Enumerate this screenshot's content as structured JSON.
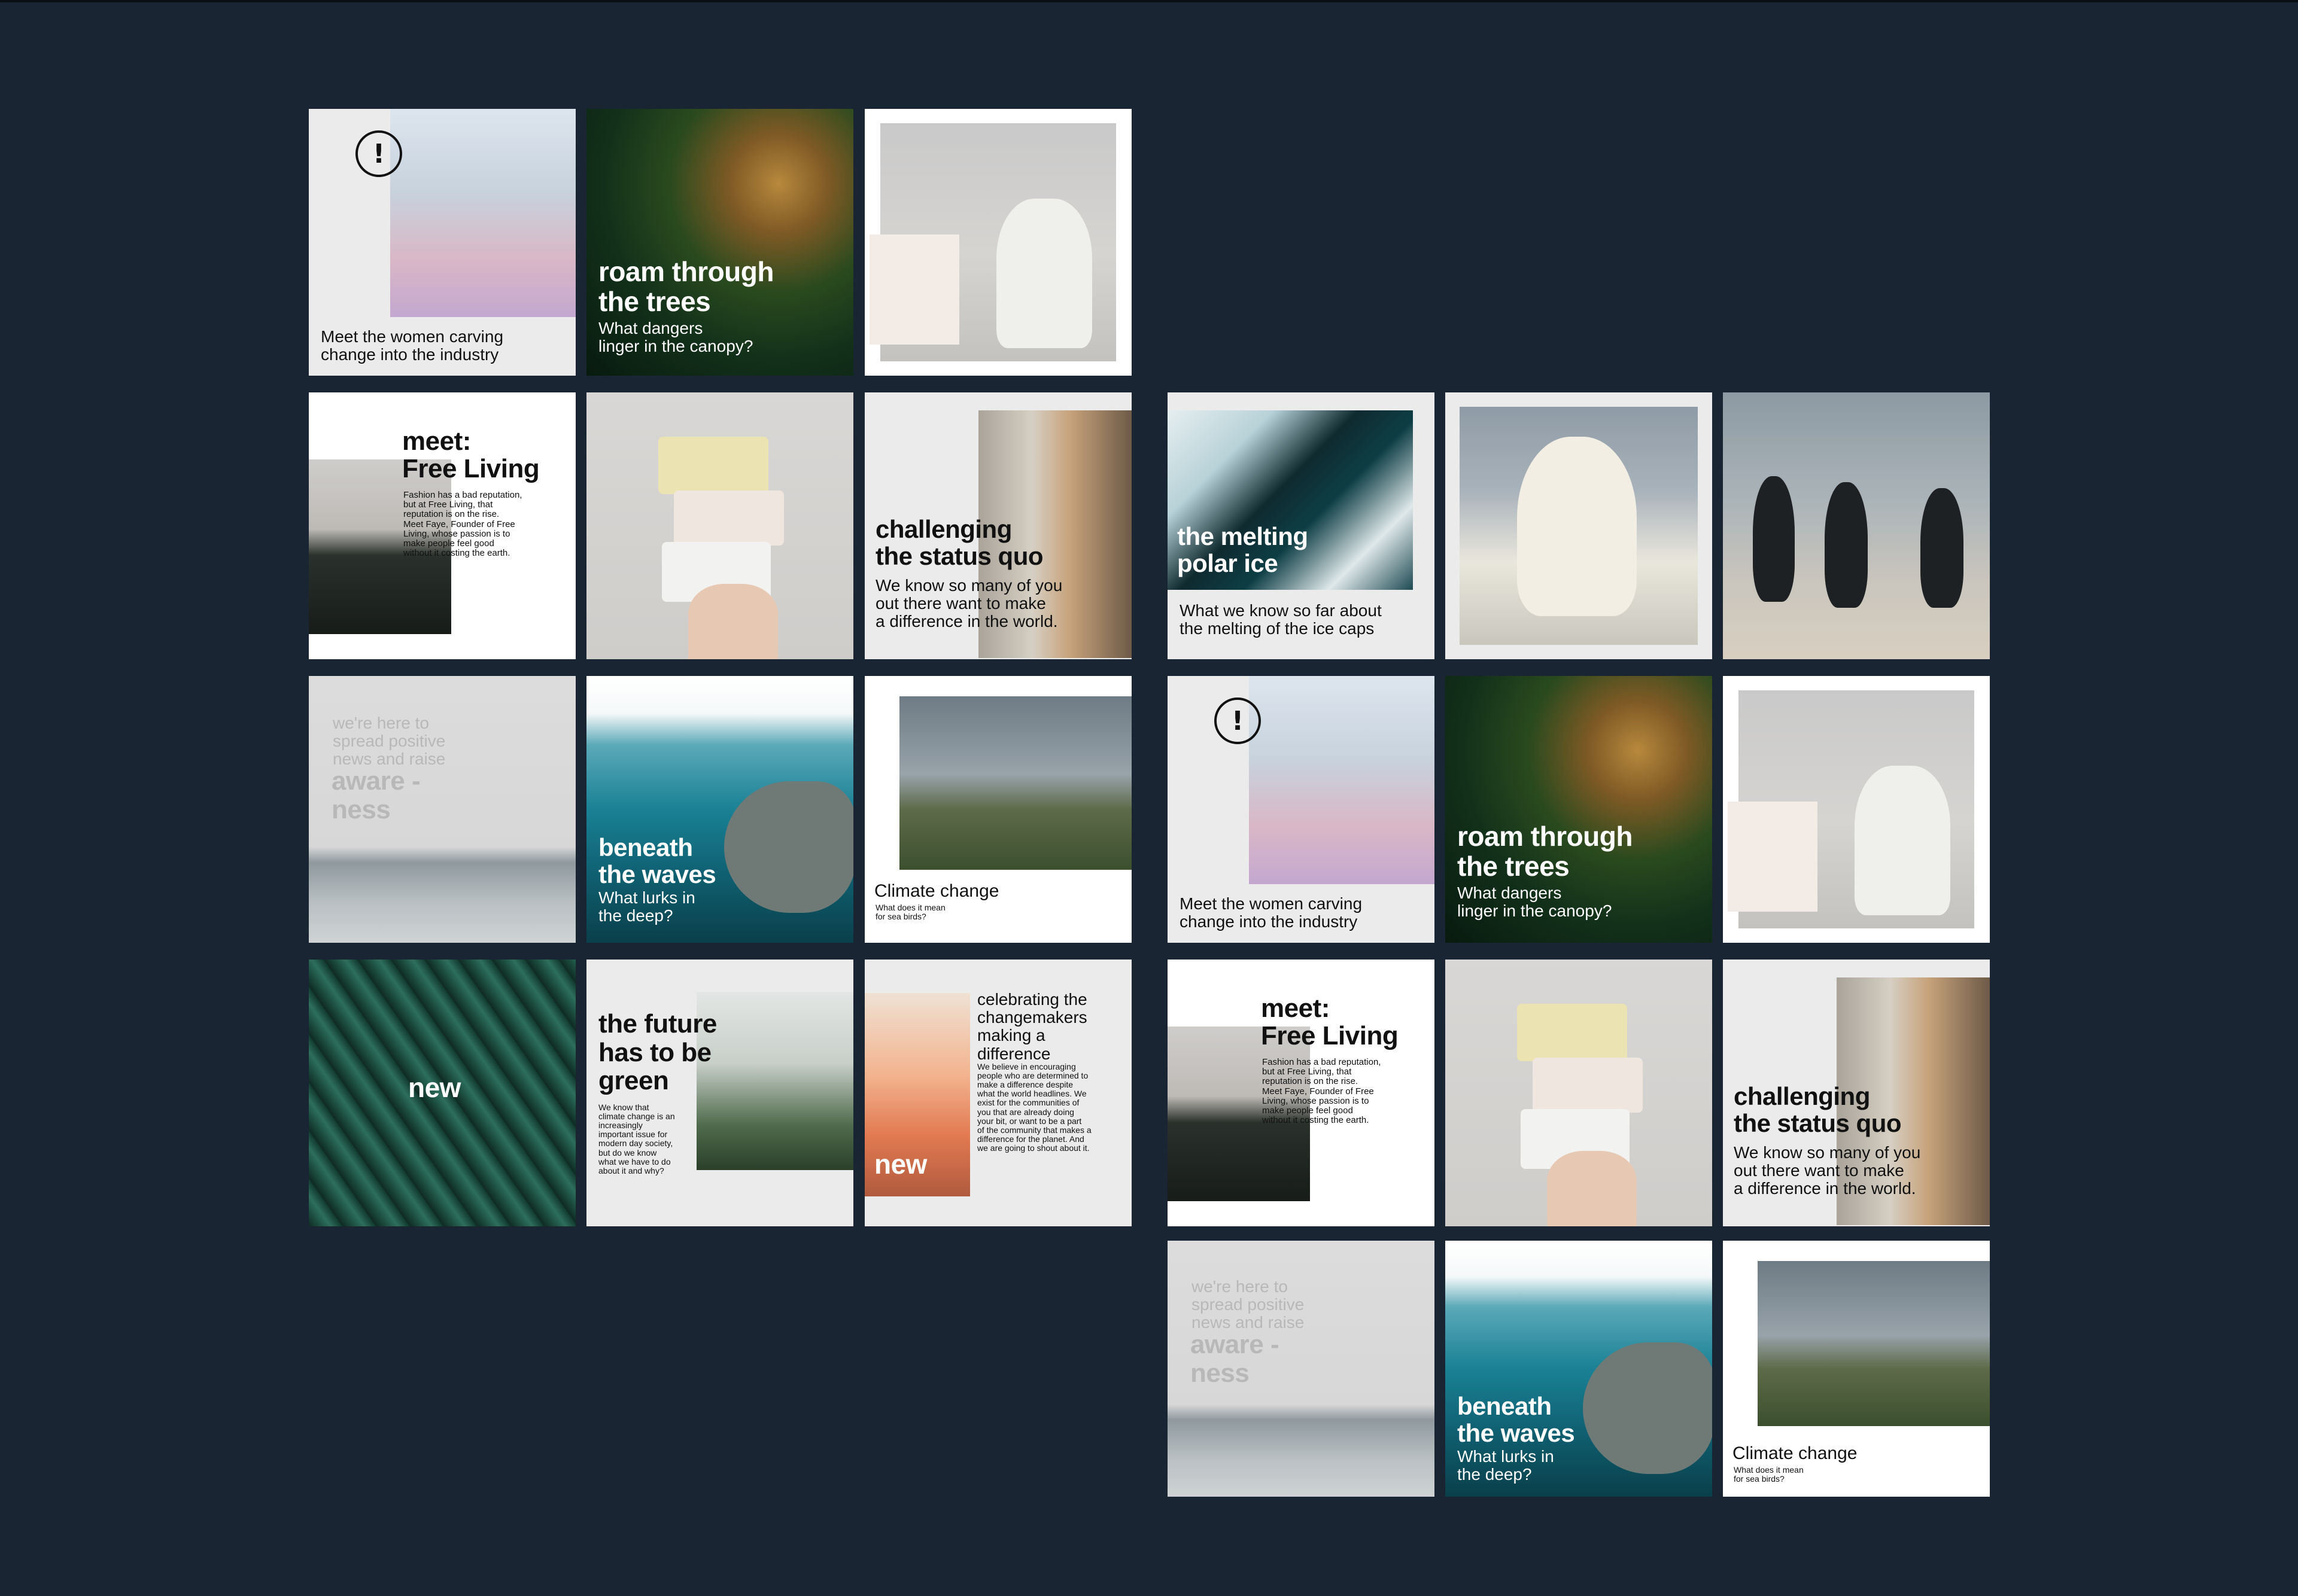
{
  "tiles": {
    "women": {
      "caption": "Meet the women carving\nchange into the industry",
      "icon": "exclamation-circle-icon"
    },
    "trees": {
      "title": "roam through\nthe trees",
      "subtitle": "What dangers\nlinger in the canopy?"
    },
    "freeliving": {
      "title_top": "meet:",
      "title_main": "Free Living",
      "body": "Fashion has a bad reputation,\nbut at Free Living, that\nreputation is on the rise.\nMeet Faye, Founder of Free\nLiving, whose passion is to\nmake people feel good\nwithout it costing the earth."
    },
    "statusquo": {
      "title": "challenging\nthe status quo",
      "body": "We know so many of you\nout there want to make\na difference in the world."
    },
    "polar": {
      "title": "the melting\npolar ice",
      "body": "What we know so far about\nthe melting of the ice caps"
    },
    "awareness": {
      "intro": "we're here to\nspread positive\nnews and raise",
      "word": "aware -\nness"
    },
    "waves": {
      "title": "beneath\nthe waves",
      "subtitle": "What lurks in\nthe deep?"
    },
    "climate": {
      "title": "Climate change",
      "subtitle": "What does it mean\nfor sea birds?"
    },
    "new": {
      "word": "new"
    },
    "future": {
      "title": "the future\nhas to be\ngreen",
      "body": "We know that\nclimate change is an\nincreasingly\nimportant issue for\nmodern day society,\nbut do we know\nwhat we have to do\nabout it and why?"
    },
    "celebrate": {
      "title": "celebrating the\nchangemakers\nmaking a\ndifference",
      "body": "We believe in encouraging\npeople who are determined to\nmake a difference despite\nwhat the world headlines. We\nexist for the communities of\nyou that are already doing\nyour bit, or want to be a part\nof the community that makes a\ndifference for the planet. And\nwe are going to shout about it.",
      "word": "new"
    }
  },
  "colors": {
    "background": "#1a2533",
    "tile": "#ebebeb",
    "text": "#111111"
  }
}
